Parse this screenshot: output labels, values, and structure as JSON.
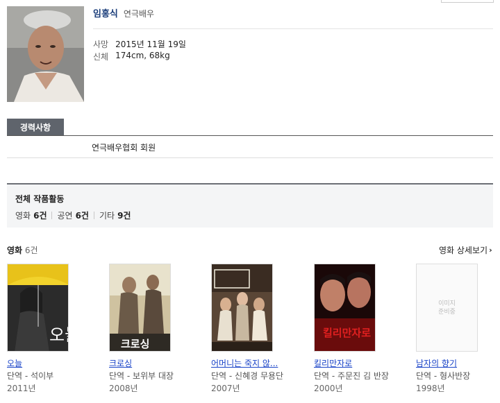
{
  "profile": {
    "name": "임홍식",
    "role": "연극배우",
    "death_label": "사망",
    "death_value": "2015년 11월 19일",
    "body_label": "신체",
    "body_value": "174cm, 68kg"
  },
  "career": {
    "tab_label": "경력사항",
    "text": "연극배우협회 회원"
  },
  "summary": {
    "title": "전체 작품활동",
    "counts": [
      {
        "label": "영화",
        "value": "6건"
      },
      {
        "label": "공연",
        "value": "6건"
      },
      {
        "label": "기타",
        "value": "9건"
      }
    ]
  },
  "films_section": {
    "label": "영화",
    "count": "6건",
    "more_label": "영화 상세보기"
  },
  "films": [
    {
      "title": "오늘",
      "role": "단역 - 석이부",
      "year": "2011년"
    },
    {
      "title": "크로싱",
      "role": "단역 - 보위부 대장",
      "year": "2008년"
    },
    {
      "title": "어머니는 죽지 않...",
      "role": "단역 - 신혜경 무용단",
      "year": "2007년"
    },
    {
      "title": "킬리만자로",
      "role": "단역 - 주문진 김 반장",
      "year": "2000년"
    },
    {
      "title": "남자의 향기",
      "role": "단역 - 형사반장",
      "year": "1998년",
      "no_image_text": [
        "이미지",
        "준비중"
      ]
    }
  ],
  "poster_text": {
    "crossing": "크로싱",
    "today": "오늘",
    "kilimanjaro": "킬리만자로"
  },
  "colors": {
    "link": "#1a44c8",
    "tab_bg": "#5f646c",
    "name": "#1a3d7a"
  }
}
